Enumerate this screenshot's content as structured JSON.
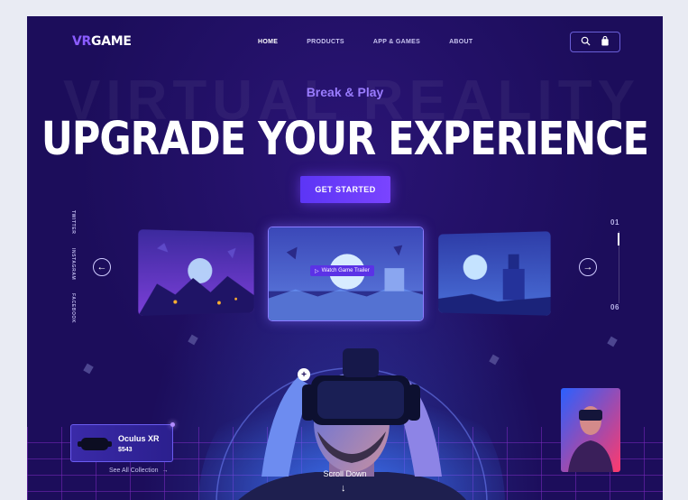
{
  "brand": {
    "vr": "VR",
    "game": "GAME"
  },
  "nav": {
    "items": [
      {
        "label": "HOME",
        "active": true
      },
      {
        "label": "PRODUCTS"
      },
      {
        "label": "APP & GAMES"
      },
      {
        "label": "ABOUT"
      }
    ],
    "icons": [
      "search-icon",
      "shopping-bag-icon"
    ]
  },
  "hero": {
    "watermark": "VIRTUAL REALITY",
    "eyebrow": "Break & Play",
    "headline": "UPGRADE YOUR EXPERIENCE",
    "cta": "GET STARTED"
  },
  "social": [
    "TWITTER",
    "INSTAGRAM",
    "FACEBOOK"
  ],
  "slider": {
    "trailer_label": "Watch Game Trailer",
    "current": "01",
    "total": "06"
  },
  "product": {
    "name": "Oculus XR",
    "price": "$543"
  },
  "see_all": "See All Collection",
  "scroll": "Scroll Down",
  "colors": {
    "background": "#1c0d5b",
    "accent": "#6a3ff7",
    "brand_vr": "#8a5cff"
  }
}
